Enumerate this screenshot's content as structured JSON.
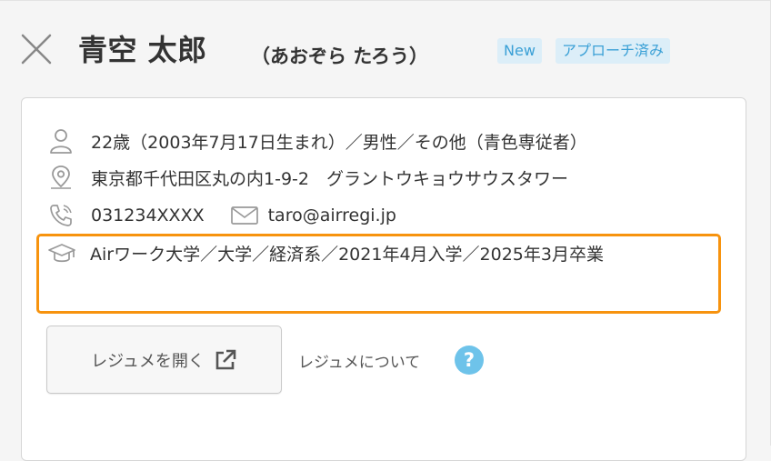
{
  "header": {
    "name": "青空 太郎",
    "kana": "（あおぞら たろう）",
    "badges": {
      "new": "New",
      "status": "アプローチ済み"
    }
  },
  "profile": {
    "age_gender": "22歳（2003年7月17日生まれ）／男性／その他（青色専従者）",
    "address": "東京都千代田区丸の内1-9-2　グラントウキョウサウスタワー",
    "phone": "031234XXXX",
    "email": "taro@airregi.jp",
    "education": "Airワーク大学／大学／経済系／2021年4月入学／2025年3月卒業"
  },
  "resume": {
    "open_label": "レジュメを開く",
    "about_label": "レジュメについて",
    "help_symbol": "?"
  },
  "icons": {
    "close": "close-icon",
    "person": "person-icon",
    "location": "location-pin-icon",
    "phone": "phone-icon",
    "mail": "mail-icon",
    "education": "graduation-cap-icon",
    "external": "external-link-icon",
    "help": "question-icon"
  },
  "colors": {
    "highlight": "#f7930e",
    "badge_bg": "#dceef8",
    "badge_text": "#3aa0d6",
    "help": "#6ec3ea"
  }
}
